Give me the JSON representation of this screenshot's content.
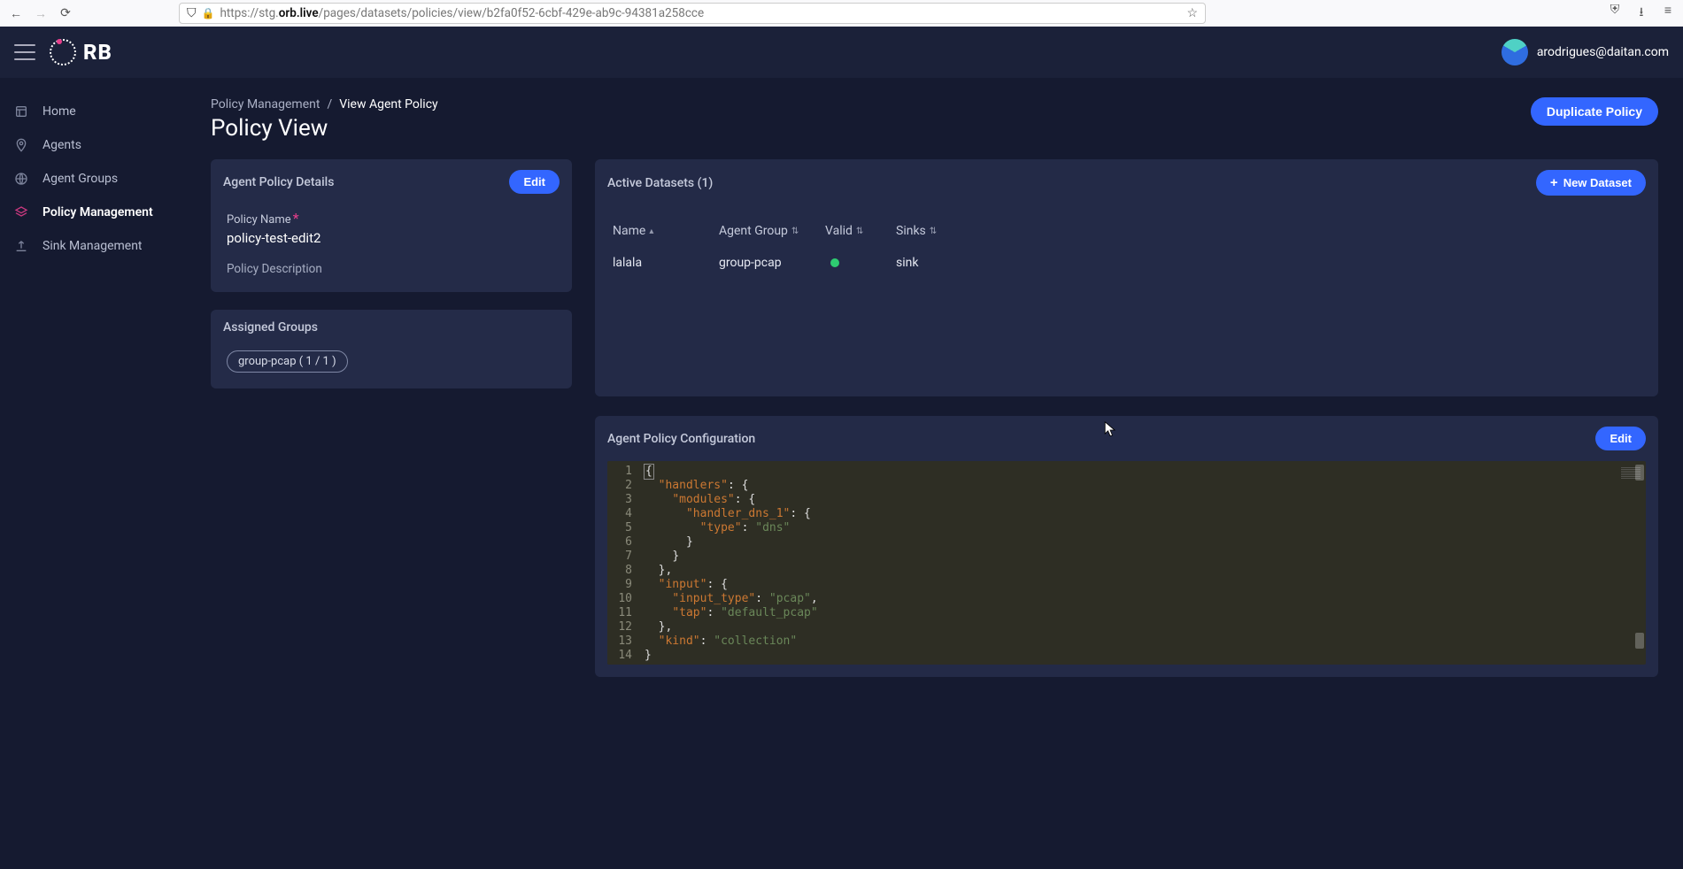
{
  "browser": {
    "url_prefix": "https://stg.",
    "url_host": "orb.live",
    "url_path": "/pages/datasets/policies/view/b2fa0f52-6cbf-429e-ab9c-94381a258cce"
  },
  "header": {
    "brand": "RB",
    "user_email": "arodrigues@daitan.com"
  },
  "sidebar": [
    {
      "icon": "home",
      "label": "Home",
      "active": false
    },
    {
      "icon": "pin",
      "label": "Agents",
      "active": false
    },
    {
      "icon": "globe",
      "label": "Agent Groups",
      "active": false
    },
    {
      "icon": "layers",
      "label": "Policy Management",
      "active": true
    },
    {
      "icon": "upload",
      "label": "Sink Management",
      "active": false
    }
  ],
  "breadcrumb": {
    "root": "Policy Management",
    "sep": "/",
    "current": "View Agent Policy"
  },
  "page_title": "Policy View",
  "actions": {
    "duplicate": "Duplicate Policy",
    "new_dataset": "New Dataset",
    "edit": "Edit"
  },
  "details": {
    "card_title": "Agent Policy Details",
    "name_label": "Policy Name",
    "name_value": "policy-test-edit2",
    "desc_label": "Policy Description"
  },
  "assigned": {
    "card_title": "Assigned Groups",
    "chip": "group-pcap ( 1 / 1 )"
  },
  "datasets": {
    "card_title": "Active Datasets (1)",
    "columns": {
      "name": "Name",
      "group": "Agent Group",
      "valid": "Valid",
      "sinks": "Sinks"
    },
    "rows": [
      {
        "name": "lalala",
        "group": "group-pcap",
        "valid": true,
        "sinks": "sink"
      }
    ]
  },
  "config": {
    "card_title": "Agent Policy Configuration",
    "json": {
      "handlers": {
        "modules": {
          "handler_dns_1": {
            "type": "dns"
          }
        }
      },
      "input": {
        "input_type": "pcap",
        "tap": "default_pcap"
      },
      "kind": "collection"
    },
    "line_count": 14
  }
}
